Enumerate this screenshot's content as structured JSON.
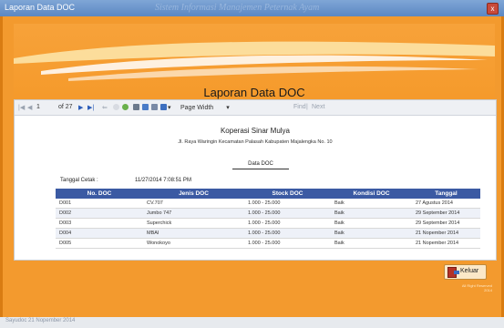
{
  "window": {
    "title": "Laporan Data DOC",
    "background_title": "Sistem Informasi Manajemen Peternak Ayam",
    "close_glyph": "x"
  },
  "page_title": "Laporan Data DOC",
  "toolbar": {
    "page_current": "1",
    "page_total": "of 27",
    "zoom": "Page Width",
    "find": "Find",
    "next": "Next"
  },
  "report": {
    "company": "Koperasi Sinar Mulya",
    "address": "Jl. Raya Waringin Kecamatan Palasah Kabupaten Majalengka No. 10",
    "subtitle": "Data DOC",
    "date_label": "Tanggal Cetak :",
    "date_value": "11/27/2014 7:08:51 PM",
    "columns": [
      "No. DOC",
      "Jenis DOC",
      "Stock DOC",
      "Kondisi DOC",
      "Tanggal"
    ],
    "rows": [
      [
        "D001",
        "CV.707",
        "1.000 - 25.000",
        "Baik",
        "27 Agustus 2014"
      ],
      [
        "D002",
        "Jumbo 747",
        "1.000 - 25.000",
        "Baik",
        "29 September 2014"
      ],
      [
        "D003",
        "Superchick",
        "1.000 - 25.000",
        "Baik",
        "29 September 2014"
      ],
      [
        "D004",
        "MBAI",
        "1.000 - 25.000",
        "Baik",
        "21 Nopember 2014"
      ],
      [
        "D005",
        "Wonokoyo",
        "1.000 - 25.000",
        "Baik",
        "21 Nopember 2014"
      ]
    ]
  },
  "buttons": {
    "keluar": "Keluar"
  },
  "footer": {
    "rights": "All Right Reserved",
    "year": "2014"
  },
  "statusbar": "Sayudoc 21 Nopember 2014",
  "colors": {
    "frame": "#f39a2e",
    "table_header": "#3b5aa3"
  }
}
